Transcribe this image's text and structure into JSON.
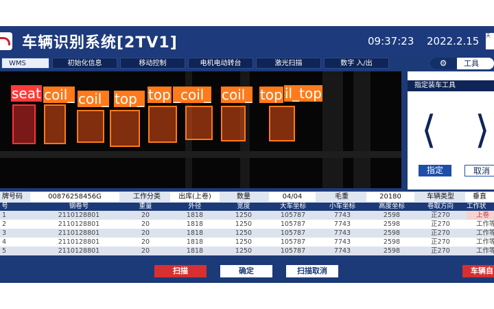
{
  "header": {
    "title": "车辆识别系统[2TV1]",
    "time": "09:37:23",
    "date": "2022.2.15",
    "corner_text": "天"
  },
  "tabs": [
    {
      "label": "WMS",
      "active": true
    },
    {
      "label": "初始化信息"
    },
    {
      "label": "移动控制"
    },
    {
      "label": "电机电动转台"
    },
    {
      "label": "激光扫描"
    },
    {
      "label": "数字 入/出"
    }
  ],
  "tools": {
    "label": "工具",
    "icon": "gear-icon"
  },
  "detections": [
    {
      "label": "seat",
      "color": "#ff3a3a"
    },
    {
      "label": "coil_"
    },
    {
      "label": "coil_"
    },
    {
      "label": "top_"
    },
    {
      "label": "top"
    },
    {
      "label": "_coil_"
    },
    {
      "label": "coil_"
    },
    {
      "label": "top"
    },
    {
      "label": "il_top"
    }
  ],
  "panel": {
    "title": "指定装车工具",
    "prev_icon": "chevron-left-icon",
    "next_icon": "chevron-right-icon",
    "assign_label": "指定",
    "cancel_label": "取消"
  },
  "info": {
    "plate_label": "牌号码",
    "plate_value": "00876258456G",
    "work_label": "工作分类",
    "work_value": "出库(上卷)",
    "qty_label": "数量",
    "qty_value": "04/04",
    "weight_label": "毛重",
    "weight_value": "20180",
    "vtype_label": "车辆类型",
    "vtype_value": "垂直"
  },
  "table": {
    "headers": [
      "号",
      "钢卷号",
      "重量",
      "外径",
      "宽度",
      "大车坐标",
      "小车坐标",
      "高度坐标",
      "卷取方向",
      "工作状"
    ],
    "rows": [
      [
        "1",
        "2110128801",
        "20",
        "1818",
        "1250",
        "105787",
        "7743",
        "2598",
        "正270",
        "上卷"
      ],
      [
        "2",
        "2110128801",
        "20",
        "1818",
        "1250",
        "105787",
        "7743",
        "2598",
        "正270",
        "工作等"
      ],
      [
        "3",
        "2110128801",
        "20",
        "1818",
        "1250",
        "105787",
        "7743",
        "2598",
        "正270",
        "工作等"
      ],
      [
        "4",
        "2110128801",
        "20",
        "1818",
        "1250",
        "105787",
        "7743",
        "2598",
        "正270",
        "工作等"
      ],
      [
        "5",
        "2110128801",
        "20",
        "1818",
        "1250",
        "105787",
        "7743",
        "2598",
        "正270",
        "工作等"
      ]
    ]
  },
  "buttons": {
    "scan": "扫描",
    "confirm": "确定",
    "scan_cancel": "扫描取消",
    "vehicle": "车辆自"
  },
  "colors": {
    "brand_blue": "#1c3a78",
    "alert_red": "#d83030",
    "detection_orange": "#ff7a1a"
  }
}
